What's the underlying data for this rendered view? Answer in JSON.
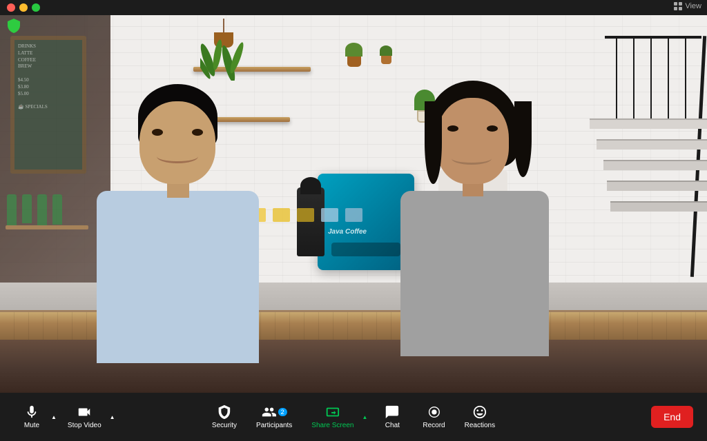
{
  "titlebar": {
    "view_label": "View",
    "shield_color": "#2ecc40"
  },
  "toolbar": {
    "mute_label": "Mute",
    "stop_video_label": "Stop Video",
    "security_label": "Security",
    "participants_label": "Participants",
    "participants_count": "2",
    "share_screen_label": "Share Screen",
    "chat_label": "Chat",
    "record_label": "Record",
    "reactions_label": "Reactions",
    "end_label": "End"
  },
  "video": {
    "background": "coffee shop with two people"
  }
}
